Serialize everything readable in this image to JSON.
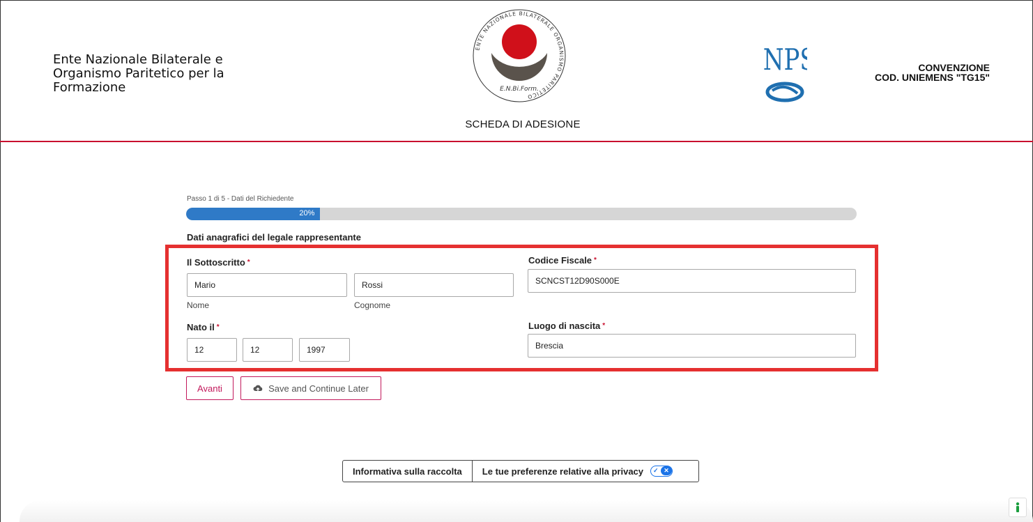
{
  "header": {
    "org_name": "Ente Nazionale Bilaterale e Organismo Paritetico per la Formazione",
    "logo_ring_text": "ENTE NAZIONALE BILATERALE ORGANISMO PARITETICO",
    "logo_abbr": "E.N.Bi.Form.",
    "form_title": "SCHEDA DI ADESIONE",
    "inps_logo_text": "INPS",
    "convention_line1": "CONVENZIONE",
    "convention_line2": "COD. UNIEMENS \"TG15\""
  },
  "progress": {
    "step_label": "Passo 1 di 5 - Dati del Richiedente",
    "percent_label": "20%",
    "fraction": 0.2
  },
  "section": {
    "title": "Dati anagrafici del legale rappresentante"
  },
  "form": {
    "sottoscritto_label": "Il Sottoscritto",
    "nome_value": "Mario",
    "nome_sub": "Nome",
    "cognome_value": "Rossi",
    "cognome_sub": "Cognome",
    "codice_fiscale_label": "Codice Fiscale",
    "codice_fiscale_value": "SCNCST12D90S000E",
    "nato_label": "Nato il",
    "day_value": "12",
    "month_value": "12",
    "year_value": "1997",
    "luogo_label": "Luogo di nascita",
    "luogo_value": "Brescia",
    "required_mark": "*"
  },
  "buttons": {
    "next": "Avanti",
    "save": "Save and Continue Later",
    "save_icon": "cloud-upload-icon"
  },
  "privacy": {
    "info_label": "Informativa sulla raccolta",
    "prefs_label": "Le tue preferenze relative alla privacy",
    "toggle_icon": "privacy-toggle-icon"
  },
  "colors": {
    "accent": "#c8102e",
    "progress": "#2f7ac7",
    "highlight": "#e53030",
    "button_border": "#c2185b"
  }
}
